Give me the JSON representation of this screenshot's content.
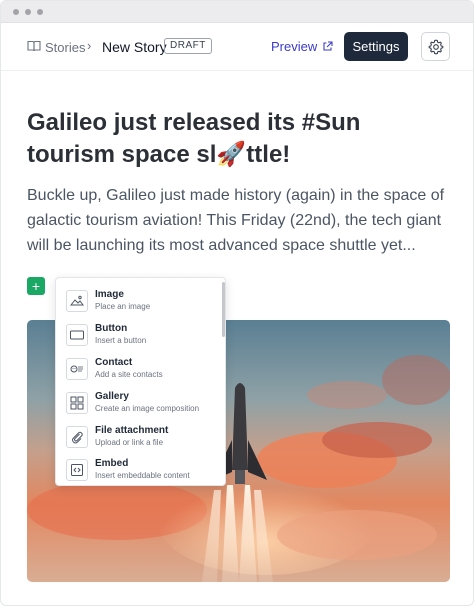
{
  "breadcrumb": {
    "root": "Stories",
    "separator": "›",
    "current": "New Story",
    "status_badge": "DRAFT"
  },
  "header": {
    "preview_label": "Preview",
    "settings_label": "Settings"
  },
  "article": {
    "title": "Galileo just released its #Sun tourism space sl🚀ttle!",
    "lead": "Buckle up, Galileo just made history (again) in the space of galactic tourism aviation! This Friday (22nd), the tech giant will be launching its most advanced space shuttle yet..."
  },
  "editor": {
    "add_block_label": "+"
  },
  "insert_menu": {
    "items": [
      {
        "label": "Image",
        "description": "Place an image",
        "icon": "image-icon"
      },
      {
        "label": "Button",
        "description": "Insert a button",
        "icon": "button-icon"
      },
      {
        "label": "Contact",
        "description": "Add a site contacts",
        "icon": "contact-icon"
      },
      {
        "label": "Gallery",
        "description": "Create an image composition",
        "icon": "gallery-icon"
      },
      {
        "label": "File attachment",
        "description": "Upload or link a file",
        "icon": "paperclip-icon"
      },
      {
        "label": "Embed",
        "description": "Insert embeddable content",
        "icon": "embed-icon"
      }
    ]
  },
  "colors": {
    "primary_dark": "#1e2a3b",
    "link": "#3b3bc7",
    "add_green": "#1aa864"
  }
}
